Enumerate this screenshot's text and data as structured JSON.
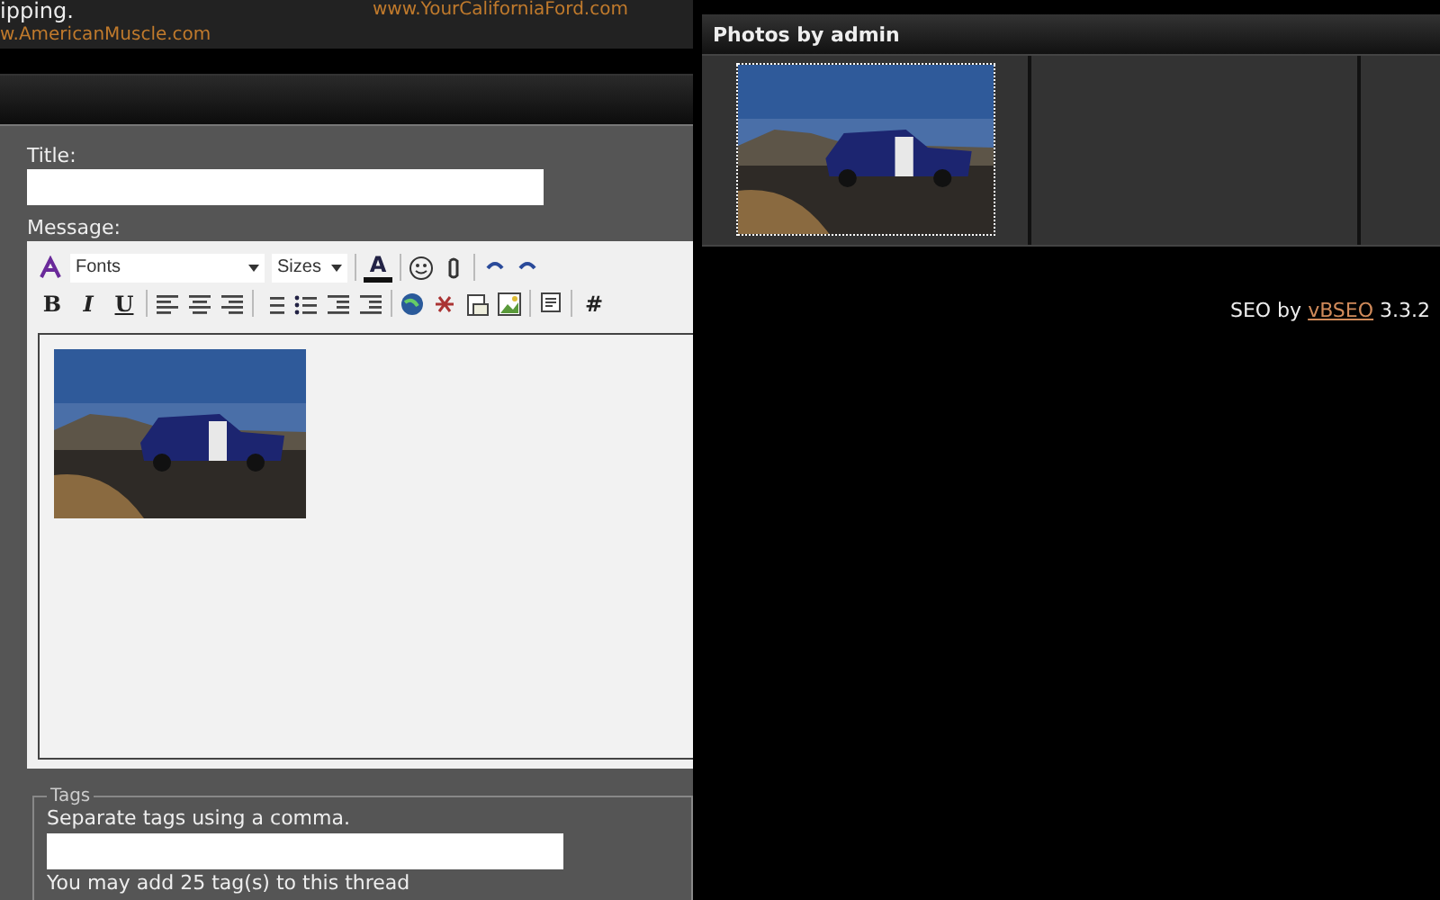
{
  "banner": {
    "text_left": "ipping.",
    "link_left": "w.AmericanMuscle.com",
    "link_right": "www.YourCaliforniaFord.com"
  },
  "form": {
    "title_label": "Title:",
    "message_label": "Message:",
    "toolbar": {
      "font_select": "Fonts",
      "size_select": "Sizes",
      "color_button": "A",
      "format_buttons": [
        "B",
        "I",
        "U"
      ],
      "code_button": "#"
    },
    "tags": {
      "legend": "Tags",
      "hint": "Separate tags using a comma.",
      "note": "You may add 25 tag(s) to this thread"
    }
  },
  "gallery": {
    "title": "Photos by admin",
    "cells": [
      {
        "kind": "photo"
      },
      {
        "kind": "empty"
      },
      {
        "kind": "empty"
      }
    ]
  },
  "footer": {
    "prefix": "SEO by",
    "link": "vBSEO",
    "suffix": "3.3.2"
  }
}
